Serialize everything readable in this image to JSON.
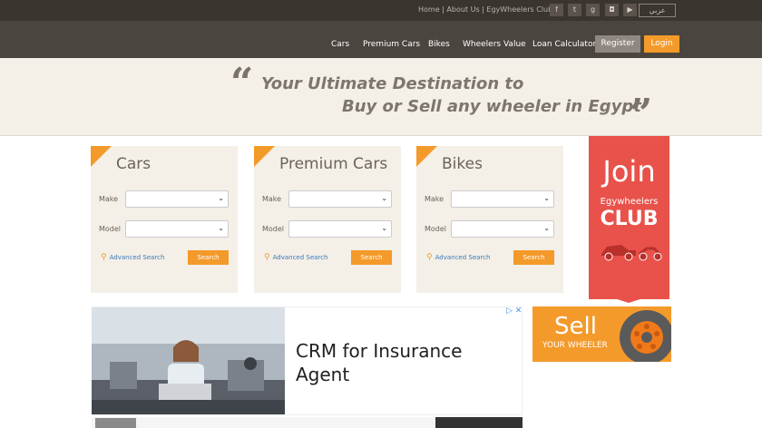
{
  "topbar": {
    "links": [
      "Home",
      "About Us",
      "EgyWheelers Club"
    ],
    "separator": " | ",
    "social_icons": [
      "facebook-icon",
      "twitter-icon",
      "google-plus-icon",
      "instagram-icon",
      "youtube-icon"
    ],
    "social_glyphs": [
      "f",
      "t",
      "g",
      "◘",
      "▶"
    ],
    "language": "عربي"
  },
  "nav": {
    "items": [
      "Cars",
      "Premium Cars",
      "Bikes",
      "Wheelers Value",
      "Loan Calculator"
    ],
    "register": "Register",
    "login": "Login"
  },
  "hero": {
    "line1": "Your Ultimate Destination to",
    "line2": "Buy or Sell any wheeler in Egypt",
    "quote_open": "“",
    "quote_close": "”"
  },
  "panels": [
    {
      "title": "Cars",
      "make_label": "Make",
      "model_label": "Model",
      "advanced": "Advanced Search",
      "search": "Search"
    },
    {
      "title": "Premium Cars",
      "make_label": "Make",
      "model_label": "Model",
      "advanced": "Advanced Search",
      "search": "Search"
    },
    {
      "title": "Bikes",
      "make_label": "Make",
      "model_label": "Model",
      "advanced": "Advanced Search",
      "search": "Search"
    }
  ],
  "club": {
    "join": "Join",
    "name": "Egywheelers",
    "club": "CLUB"
  },
  "ad": {
    "headline": "CRM for Insurance Agent",
    "choices": "▷ ✕"
  },
  "sell": {
    "big": "Sell",
    "small": "YOUR WHEELER"
  },
  "colors": {
    "accent": "#f49a2b",
    "nav_bg": "#4b4540",
    "topbar_bg": "#3b3530",
    "hero_bg": "#f4efe7",
    "club_red": "#e8524a"
  }
}
